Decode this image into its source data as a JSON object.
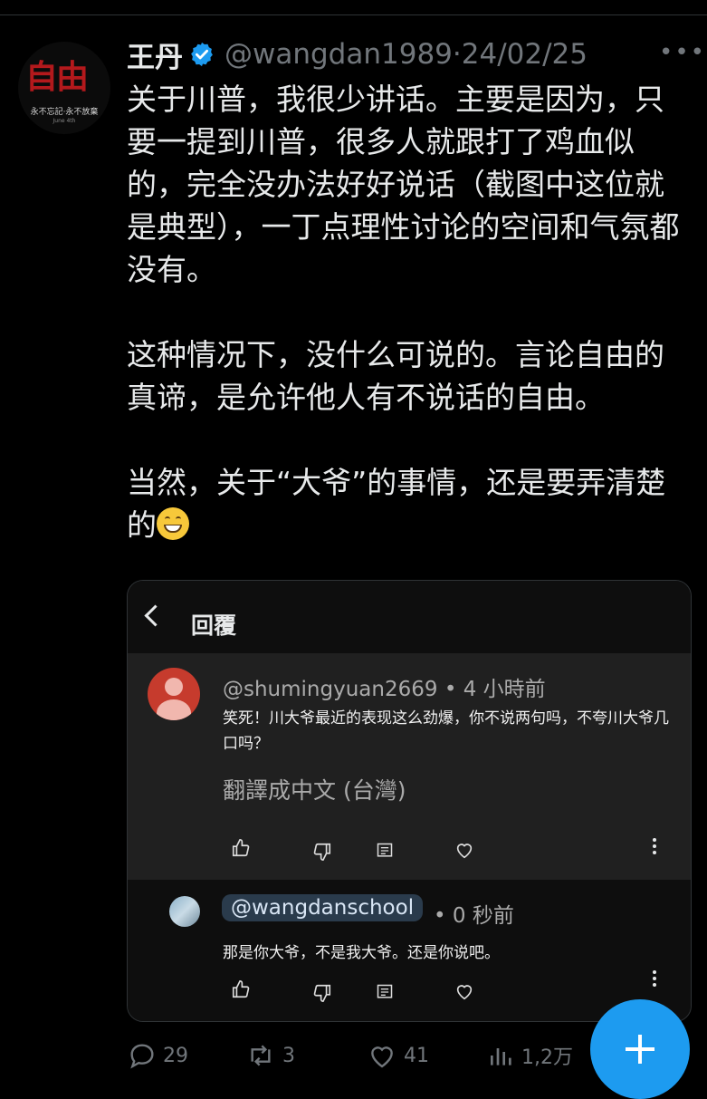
{
  "tweet": {
    "author_name": "王丹",
    "handle_date": "@wangdan1989·24/02/25",
    "avatar_text": "自由",
    "avatar_sub1": "永不忘記·永不放棄",
    "avatar_sub2": "June 4th",
    "paragraphs": [
      "关于川普，我很少讲话。主要是因为，只要一提到川普，很多人就跟打了鸡血似的，完全没办法好好说话（截图中这位就是典型），一丁点理性讨论的空间和气氛都没有。",
      "这种情况下，没什么可说的。言论自由的真谛，是允许他人有不说话的自由。",
      "当然，关于“大爷”的事情，还是要弄清楚的"
    ],
    "more_icon": "more-horizontal-icon",
    "verified_color": "#1d9bf0"
  },
  "embedded": {
    "title": "回覆",
    "comment1": {
      "header": "@shumingyuan2669 • 4 小時前",
      "body": "笑死！川大爷最近的表现这么劲爆，你不说两句吗，不夸川大爷几口吗？",
      "translate": "翻譯成中文 (台灣)"
    },
    "comment2": {
      "mention": "@wangdanschool",
      "time": "• 0 秒前",
      "body": "那是你大爷，不是我大爷。还是你说吧。"
    }
  },
  "metrics": {
    "replies": "29",
    "retweets": "3",
    "likes": "41",
    "views": "1,2万"
  },
  "colors": {
    "accent": "#1d9bf0",
    "muted": "#71767b",
    "background": "#000000"
  }
}
